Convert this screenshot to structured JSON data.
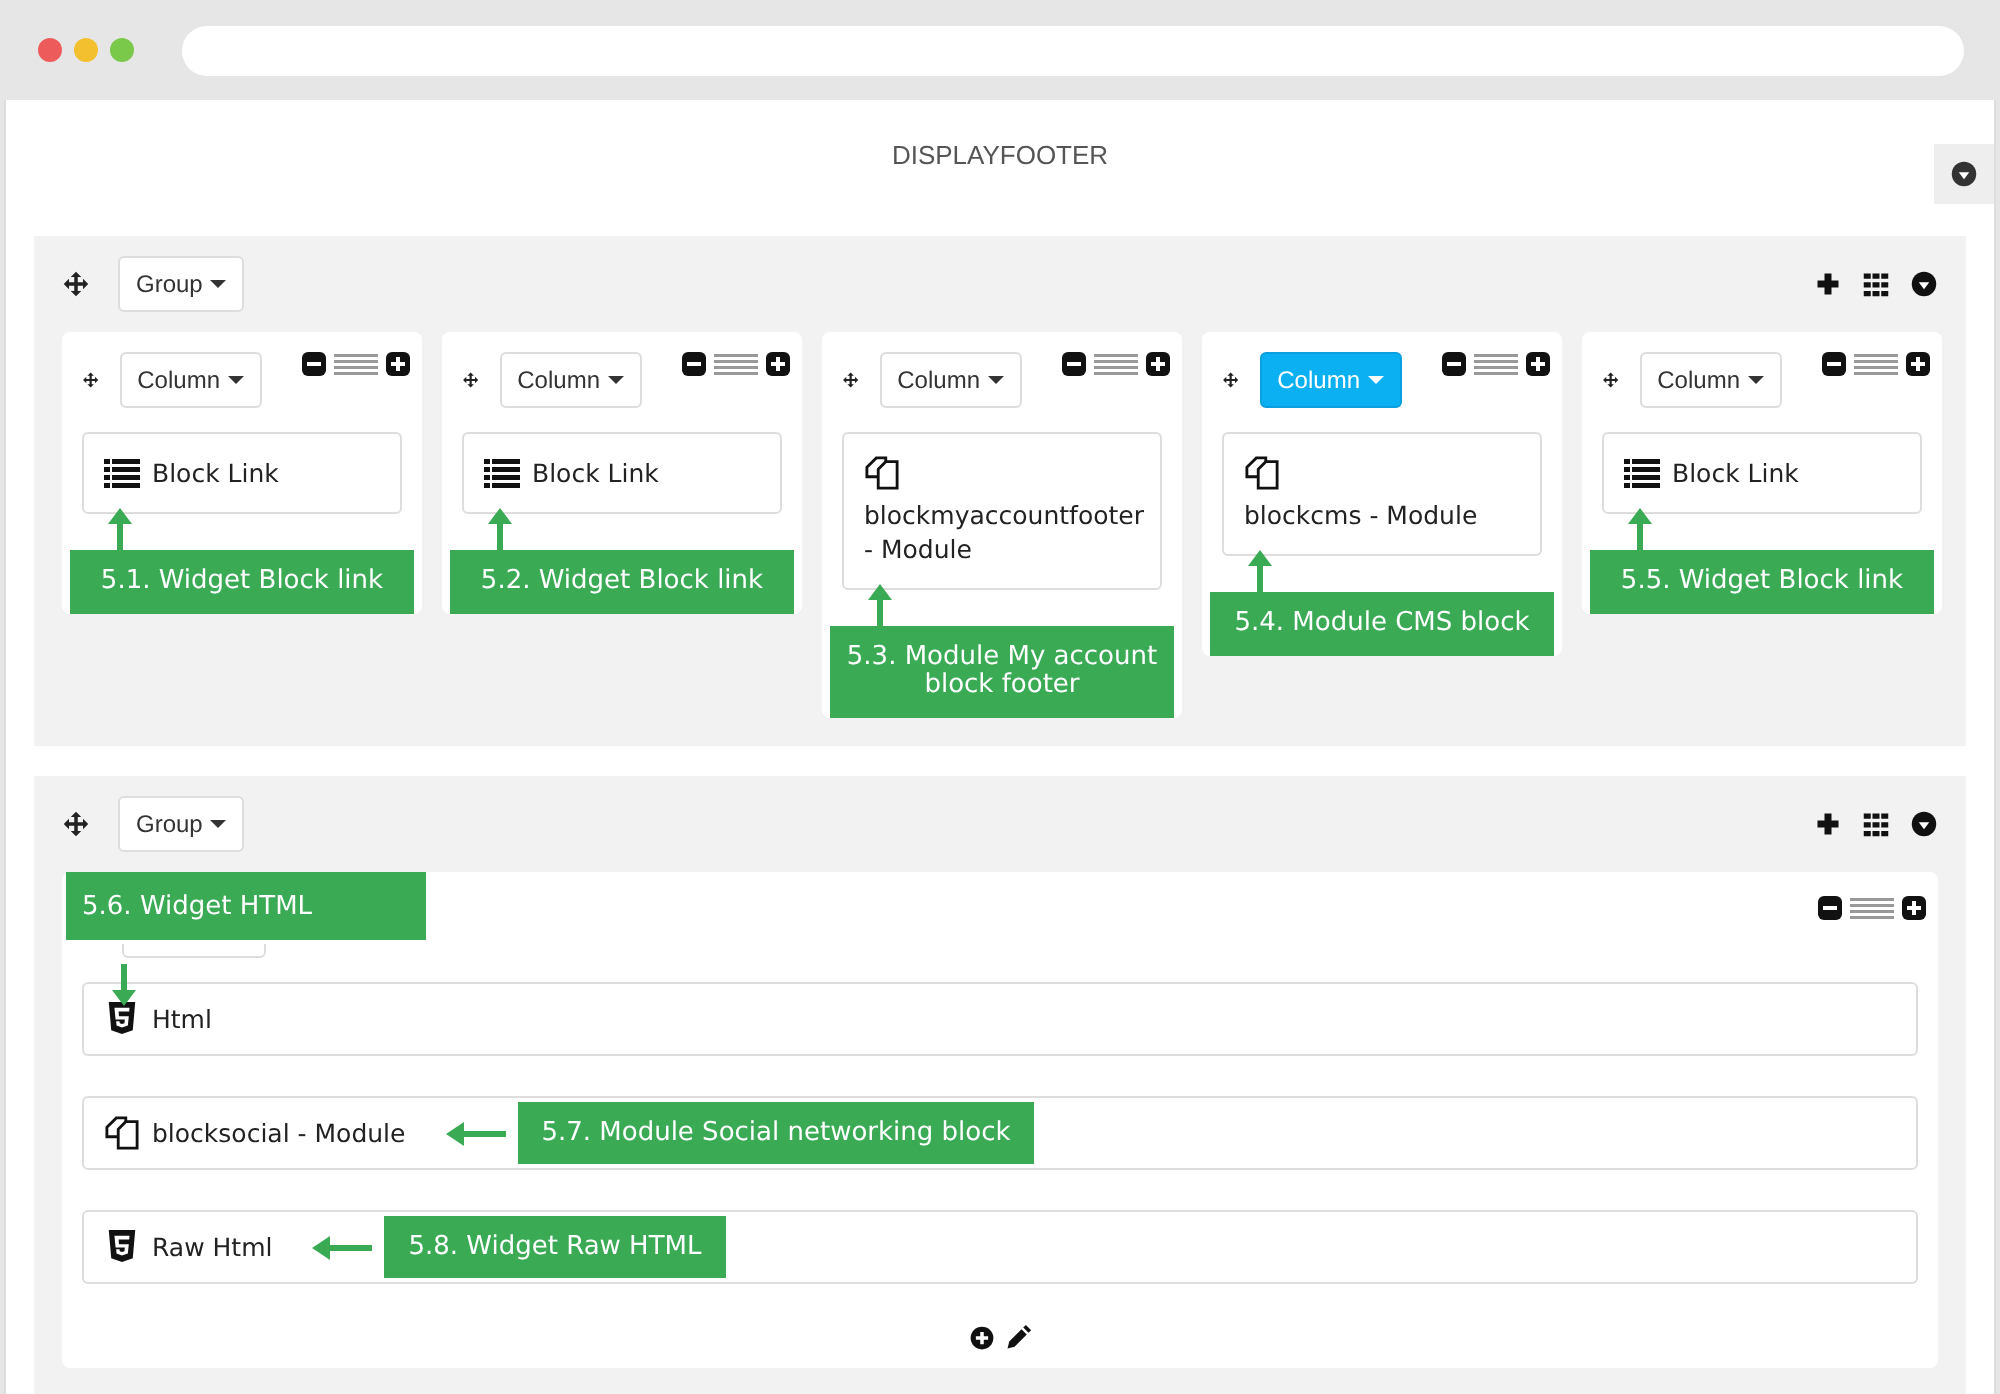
{
  "page": {
    "title": "DISPLAYFOOTER"
  },
  "groups": [
    {
      "label": "Group",
      "kind": "columns",
      "columns": [
        {
          "label": "Column",
          "selected": false,
          "widgets": [
            {
              "kind": "list",
              "label": "Block Link",
              "callout": {
                "text": "5.1. Widget Block link",
                "kind": "below"
              }
            }
          ]
        },
        {
          "label": "Column",
          "selected": false,
          "widgets": [
            {
              "kind": "list",
              "label": "Block Link",
              "callout": {
                "text": "5.2. Widget Block link",
                "kind": "below"
              }
            }
          ]
        },
        {
          "label": "Column",
          "selected": false,
          "widgets": [
            {
              "kind": "module",
              "label": "blockmyaccountfooter - Module",
              "callout": {
                "text": "5.3. Module My account block footer",
                "kind": "below"
              }
            }
          ]
        },
        {
          "label": "Column",
          "selected": true,
          "widgets": [
            {
              "kind": "module",
              "label": "blockcms - Module",
              "callout": {
                "text": "5.4. Module CMS block",
                "kind": "below"
              }
            }
          ]
        },
        {
          "label": "Column",
          "selected": false,
          "widgets": [
            {
              "kind": "list",
              "label": "Block Link",
              "callout": {
                "text": "5.5. Widget Block link",
                "kind": "below"
              }
            }
          ]
        }
      ]
    },
    {
      "label": "Group",
      "kind": "rows",
      "columns": [
        {
          "selected": false,
          "widgets": [
            {
              "kind": "html",
              "label": "Html",
              "callout": {
                "text": "5.6. Widget HTML",
                "kind": "above"
              }
            },
            {
              "kind": "module",
              "label": "blocksocial - Module",
              "callout": {
                "text": "5.7. Module Social networking block",
                "kind": "right"
              }
            },
            {
              "kind": "html",
              "label": "Raw Html",
              "callout": {
                "text": "5.8. Widget Raw HTML",
                "kind": "right"
              }
            }
          ]
        }
      ]
    }
  ]
}
